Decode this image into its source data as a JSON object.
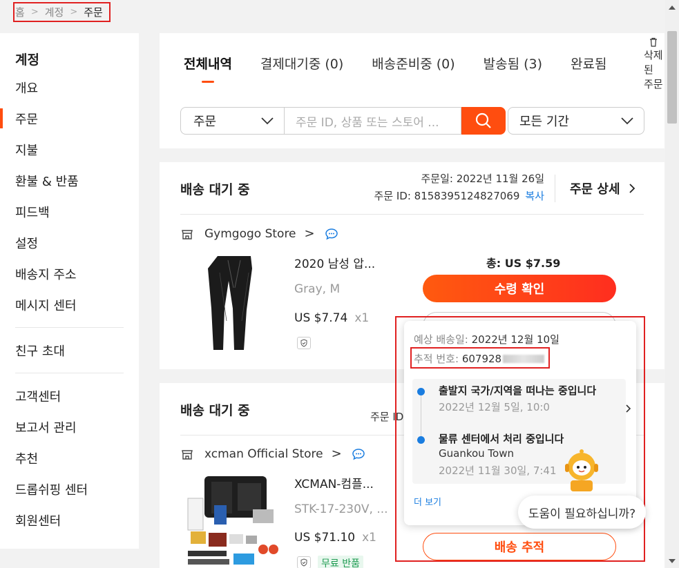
{
  "breadcrumb": {
    "home": "홈",
    "account": "계정",
    "current": "주문",
    "sep": ">"
  },
  "sidebar": {
    "title": "계정",
    "group1": [
      {
        "label": "개요"
      },
      {
        "label": "주문"
      },
      {
        "label": "지불"
      },
      {
        "label": "환불 & 반품"
      },
      {
        "label": "피드백"
      },
      {
        "label": "설정"
      },
      {
        "label": "배송지 주소"
      },
      {
        "label": "메시지 센터"
      }
    ],
    "group2": [
      {
        "label": "친구 초대"
      }
    ],
    "group3": [
      {
        "label": "고객센터"
      },
      {
        "label": "보고서 관리"
      },
      {
        "label": "추천"
      },
      {
        "label": "드롭쉬핑 센터"
      },
      {
        "label": "회원센터"
      }
    ],
    "active_index": 1
  },
  "tabs": [
    {
      "label": "전체내역"
    },
    {
      "label": "결제대기중 (0)"
    },
    {
      "label": "배송준비중 (0)"
    },
    {
      "label": "발송됨 (3)"
    },
    {
      "label": "완료됨"
    }
  ],
  "delete_tab": {
    "line1": "삭제",
    "line2": "된",
    "line3": "주문"
  },
  "search": {
    "select_value": "주문",
    "placeholder": "주문 ID, 상품 또는 스토어 ...",
    "period_value": "모든 기간"
  },
  "orders": [
    {
      "status": "배송 대기 중",
      "date_line": "주문일: 2022년 11월 26일",
      "id_line": "주문 ID: 8158395124827069",
      "copy": "복사",
      "detail": "주문 상세",
      "store": "Gymgogo Store",
      "product_name": "2020 남성 압...",
      "variant": "Gray, M",
      "price": "US $7.74",
      "qty": "x1",
      "total": "총: US $7.59",
      "confirm": "수령 확인"
    },
    {
      "status": "배송 대기 중",
      "id_line": "주문 ID",
      "store": "xcman Official Store",
      "product_name": "XCMAN-컴플...",
      "variant": "STK-17-230V, ...",
      "price": "US $71.10",
      "qty": "x1",
      "free_return": "무료 반품",
      "track": "배송 추적"
    }
  ],
  "tracking_popup": {
    "eta_label": "예상 배송일:",
    "eta_value": "2022년 12월 10일",
    "tracking_label": "추적 번호:",
    "tracking_value": "607928",
    "events": [
      {
        "title": "출발지 국가/지역을 떠나는 중입니다",
        "sub": "",
        "time": "2022년 12월 5일, 10:0"
      },
      {
        "title": "물류 센터에서 처리 중입니다",
        "sub": "Guankou Town",
        "time": "2022년 11월 30일, 7:41"
      }
    ],
    "more": "더 보기"
  },
  "help": {
    "text": "도움이 필요하십니까?"
  },
  "colors": {
    "accent": "#ff4d0f",
    "link": "#1a7de0",
    "highlight_box": "#e02020"
  }
}
